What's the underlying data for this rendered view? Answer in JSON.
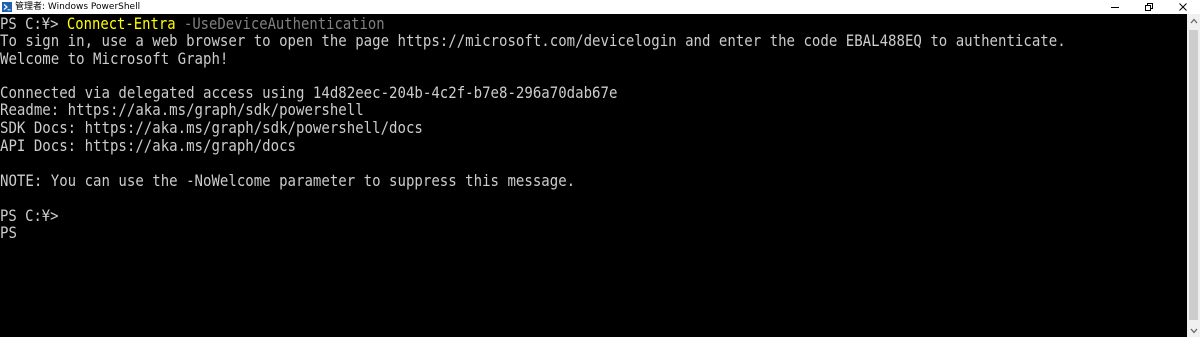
{
  "window": {
    "title": "管理者: Windows PowerShell"
  },
  "console": {
    "prompt1": "PS C:¥> ",
    "command_name": "Connect-Entra",
    "command_param": " -UseDeviceAuthentication",
    "signin_line": "To sign in, use a web browser to open the page https://microsoft.com/devicelogin and enter the code EBAL488EQ to authenticate.",
    "welcome_line": "Welcome to Microsoft Graph!",
    "connected_line": "Connected via delegated access using 14d82eec-204b-4c2f-b7e8-296a70dab67e",
    "readme_line": "Readme: https://aka.ms/graph/sdk/powershell",
    "sdk_docs_line": "SDK Docs: https://aka.ms/graph/sdk/powershell/docs",
    "api_docs_line": "API Docs: https://aka.ms/graph/docs",
    "note_line": "NOTE: You can use the -NoWelcome parameter to suppress this message.",
    "prompt2": "PS C:¥>",
    "prompt3": "PS"
  },
  "colors": {
    "background": "#000000",
    "text": "#cccccc",
    "command": "#ffff00",
    "parameter": "#808080"
  },
  "icons": {
    "app": "powershell-icon",
    "minimize": "minimize-icon",
    "restore": "restore-icon",
    "close": "close-icon",
    "scroll_up": "chevron-up-icon",
    "scroll_down": "chevron-down-icon"
  }
}
